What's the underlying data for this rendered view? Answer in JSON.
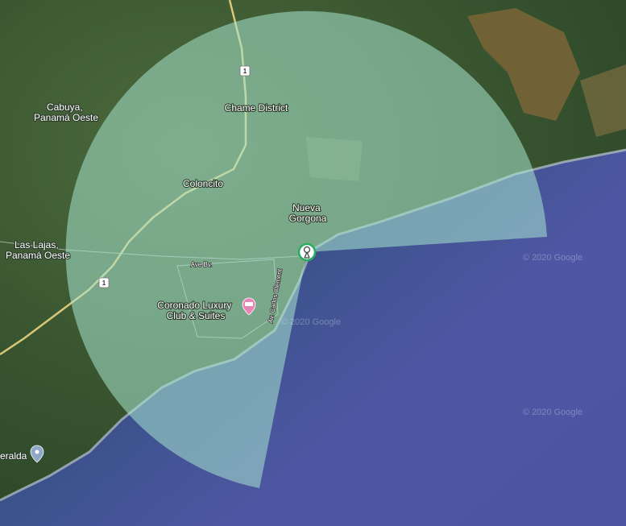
{
  "colors": {
    "top_bar": "#1a73e8",
    "ocean_deep": "#5058a6",
    "ocean_near": "#1f4a5a",
    "land": "#3c5a34",
    "sector_fill": "#a8e6cf",
    "marker_ring": "#27ae60",
    "hotel_pin": "#e985b5",
    "place_pin": "#8ea8c8"
  },
  "places": {
    "cabuya": {
      "line1": "Cabuya,",
      "line2": "Panamá Oeste"
    },
    "chame": {
      "label": "Chame District"
    },
    "coloncito": {
      "label": "Coloncito"
    },
    "nueva_gorgona": {
      "line1": "Nueva",
      "line2": "Gorgona"
    },
    "las_lajas": {
      "line1": "Las Lajas,",
      "line2": "Panamá Oeste"
    },
    "coronado": {
      "line1": "Coronado Luxury",
      "line2": "Club & Suites"
    },
    "esmeralda": {
      "label": "eralda"
    }
  },
  "roads": {
    "route_shield": "1",
    "ave_bv": "Ave Bv.",
    "carlos_clement": "Av. Carlos Clement"
  },
  "watermarks": [
    "© 2020 Google",
    "© 2020 Google",
    "© 2020 Google"
  ],
  "icons": {
    "center_marker": "antenna-icon",
    "hotel": "hotel-bed-icon",
    "place": "map-pin-icon"
  }
}
